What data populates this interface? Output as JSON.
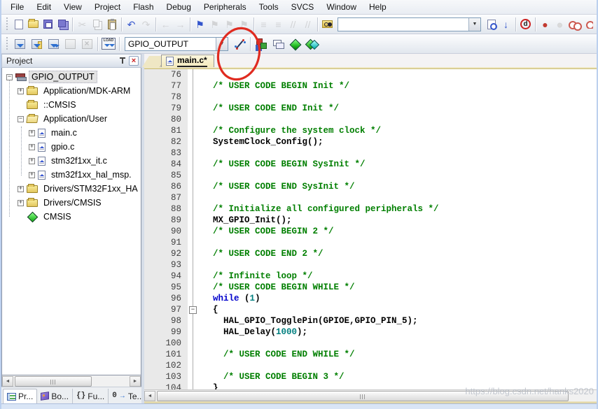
{
  "glyphs": {
    "plus": "+",
    "minus": "−",
    "fold_minus": "−",
    "scroll_left": "◄",
    "scroll_right": "►",
    "dropdown": "▼",
    "close": "×"
  },
  "colors": {
    "comment": "#007f00",
    "keyword": "#0000cc",
    "number": "#007f7f",
    "annotation": "#e02b20",
    "breakpoint_red": "#c23a30"
  },
  "menu": {
    "items": [
      "File",
      "Edit",
      "View",
      "Project",
      "Flash",
      "Debug",
      "Peripherals",
      "Tools",
      "SVCS",
      "Window",
      "Help"
    ]
  },
  "toolbar1": {
    "search_value": "",
    "buttons": [
      {
        "name": "new-file",
        "icon": "i-doc",
        "en": true
      },
      {
        "name": "open",
        "icon": "i-folder",
        "en": true
      },
      {
        "name": "save",
        "icon": "i-save",
        "en": true
      },
      {
        "name": "save-all",
        "icon": "i-saveall",
        "en": true
      },
      {
        "sep": true
      },
      {
        "name": "cut",
        "glyph": "✂",
        "cls": "g-gray",
        "en": false
      },
      {
        "name": "copy",
        "icon": "i-copy",
        "en": false
      },
      {
        "name": "paste",
        "icon": "i-paste",
        "en": true
      },
      {
        "sep": true
      },
      {
        "name": "undo",
        "glyph": "↶",
        "cls": "g-blue",
        "en": true
      },
      {
        "name": "redo",
        "glyph": "↷",
        "cls": "g-gray",
        "en": false
      },
      {
        "sep": true
      },
      {
        "name": "nav-back",
        "glyph": "←",
        "cls": "g-gray",
        "en": false
      },
      {
        "name": "nav-forward",
        "glyph": "→",
        "cls": "g-gray",
        "en": false
      },
      {
        "sep": true
      },
      {
        "name": "bookmark-toggle",
        "glyph": "⚑",
        "cls": "g-blue",
        "en": true
      },
      {
        "name": "bookmark-previous",
        "glyph": "⚑",
        "cls": "g-gray",
        "en": false
      },
      {
        "name": "bookmark-next",
        "glyph": "⚑",
        "cls": "g-gray",
        "en": false
      },
      {
        "name": "bookmark-clear-all",
        "glyph": "⚑",
        "cls": "g-gray",
        "en": false
      },
      {
        "sep": true
      },
      {
        "name": "indent",
        "glyph": "≡",
        "cls": "g-gray",
        "en": false
      },
      {
        "name": "unindent",
        "glyph": "≡",
        "cls": "g-gray",
        "en": false
      },
      {
        "name": "comment-selection",
        "glyph": "//",
        "cls": "g-gray",
        "en": false
      },
      {
        "name": "uncomment-selection",
        "glyph": "//",
        "cls": "g-gray",
        "en": false
      },
      {
        "sep": true
      },
      {
        "name": "find-in-files",
        "icon": "i-findfiles",
        "en": true
      },
      {
        "combo": "search"
      },
      {
        "name": "find",
        "icon": "i-find",
        "en": true
      },
      {
        "name": "incremental-find",
        "glyph": "↓",
        "cls": "g-blue",
        "en": true
      },
      {
        "sep": true
      },
      {
        "name": "find-all-references",
        "icon": "i-findd",
        "glyph": "d",
        "en": true
      },
      {
        "sep": true
      },
      {
        "name": "insert-breakpoint",
        "glyph": "●",
        "cls": "g-red",
        "en": true
      },
      {
        "name": "enable-disable-breakpoint",
        "glyph": "●",
        "cls": "g-light",
        "en": true
      },
      {
        "name": "kill-all-breakpoints",
        "icon": "i-bpkill",
        "en": true
      },
      {
        "name": "disable-all-breakpoints",
        "icon": "i-bpdis",
        "en": true
      }
    ]
  },
  "toolbar2": {
    "target_value": "GPIO_OUTPUT",
    "load_label": "LOAD",
    "buttons": [
      {
        "name": "translate",
        "icon": "i-build1",
        "en": true
      },
      {
        "name": "build",
        "icon": "i-build2",
        "en": true
      },
      {
        "name": "rebuild-all",
        "icon": "i-build3",
        "en": true
      },
      {
        "name": "batch-build",
        "icon": "i-build4",
        "en": false
      },
      {
        "name": "stop-build",
        "icon": "i-stop",
        "en": false
      },
      {
        "sep": true
      },
      {
        "name": "download",
        "icon": "i-load",
        "en": true
      },
      {
        "sep": true
      },
      {
        "combo": "target"
      },
      {
        "name": "options-for-target",
        "icon": "i-wand",
        "en": true
      },
      {
        "sep": true
      },
      {
        "name": "file-extensions-books",
        "icon": "i-cube",
        "en": true
      },
      {
        "name": "manage-project-items",
        "icon": "i-manage",
        "en": true
      },
      {
        "name": "manage-run-time-environment",
        "icon": "i-rte",
        "en": true
      },
      {
        "name": "pack-installer",
        "icon": "i-pack",
        "en": true
      }
    ]
  },
  "project_panel": {
    "title": "Project",
    "tree": [
      {
        "label": "GPIO_OUTPUT",
        "level": 0,
        "icon": "target",
        "expand": "minus",
        "selected": true
      },
      {
        "label": "Application/MDK-ARM",
        "level": 1,
        "icon": "folder",
        "expand": "plus"
      },
      {
        "label": "::CMSIS",
        "level": 1,
        "icon": "folder",
        "expand": null
      },
      {
        "label": "Application/User",
        "level": 1,
        "icon": "folder-open",
        "expand": "minus"
      },
      {
        "label": "main.c",
        "level": 2,
        "icon": "file",
        "expand": "plus"
      },
      {
        "label": "gpio.c",
        "level": 2,
        "icon": "file",
        "expand": "plus"
      },
      {
        "label": "stm32f1xx_it.c",
        "level": 2,
        "icon": "file",
        "expand": "plus"
      },
      {
        "label": "stm32f1xx_hal_msp.",
        "level": 2,
        "icon": "file",
        "expand": "plus"
      },
      {
        "label": "Drivers/STM32F1xx_HA",
        "level": 1,
        "icon": "folder",
        "expand": "plus"
      },
      {
        "label": "Drivers/CMSIS",
        "level": 1,
        "icon": "folder",
        "expand": "plus"
      },
      {
        "label": "CMSIS",
        "level": 1,
        "icon": "diamond",
        "expand": null
      }
    ]
  },
  "bottom_tabs": [
    {
      "name": "project",
      "icon": "ptab",
      "label": "Pr...",
      "active": true
    },
    {
      "name": "books",
      "icon": "book",
      "label": "Bo...",
      "active": false
    },
    {
      "name": "functions",
      "glyph": "{}",
      "label": "Fu...",
      "active": false
    },
    {
      "name": "templates",
      "glyph": "0",
      "glyph2": "→",
      "label": "Te...",
      "active": false
    }
  ],
  "editor": {
    "tab_label": "main.c*",
    "lines": [
      {
        "n": 76,
        "parts": []
      },
      {
        "n": 77,
        "parts": [
          {
            "t": "  /* USER CODE BEGIN Init */",
            "c": "com"
          }
        ]
      },
      {
        "n": 78,
        "parts": []
      },
      {
        "n": 79,
        "parts": [
          {
            "t": "  /* USER CODE END Init */",
            "c": "com"
          }
        ]
      },
      {
        "n": 80,
        "parts": []
      },
      {
        "n": 81,
        "parts": [
          {
            "t": "  /* Configure the system clock */",
            "c": "com"
          }
        ]
      },
      {
        "n": 82,
        "parts": [
          {
            "t": "  SystemClock_Config();",
            "c": "pln"
          }
        ]
      },
      {
        "n": 83,
        "parts": []
      },
      {
        "n": 84,
        "parts": [
          {
            "t": "  /* USER CODE BEGIN SysInit */",
            "c": "com"
          }
        ]
      },
      {
        "n": 85,
        "parts": []
      },
      {
        "n": 86,
        "parts": [
          {
            "t": "  /* USER CODE END SysInit */",
            "c": "com"
          }
        ]
      },
      {
        "n": 87,
        "parts": []
      },
      {
        "n": 88,
        "parts": [
          {
            "t": "  /* Initialize all configured peripherals */",
            "c": "com"
          }
        ]
      },
      {
        "n": 89,
        "parts": [
          {
            "t": "  MX_GPIO_Init();",
            "c": "pln"
          }
        ]
      },
      {
        "n": 90,
        "parts": [
          {
            "t": "  /* USER CODE BEGIN 2 */",
            "c": "com"
          }
        ]
      },
      {
        "n": 91,
        "parts": []
      },
      {
        "n": 92,
        "parts": [
          {
            "t": "  /* USER CODE END 2 */",
            "c": "com"
          }
        ]
      },
      {
        "n": 93,
        "parts": []
      },
      {
        "n": 94,
        "parts": [
          {
            "t": "  /* Infinite loop */",
            "c": "com"
          }
        ]
      },
      {
        "n": 95,
        "parts": [
          {
            "t": "  /* USER CODE BEGIN WHILE */",
            "c": "com"
          }
        ]
      },
      {
        "n": 96,
        "parts": [
          {
            "t": "  ",
            "c": "pln"
          },
          {
            "t": "while",
            "c": "kw"
          },
          {
            "t": " (",
            "c": "pln"
          },
          {
            "t": "1",
            "c": "num"
          },
          {
            "t": ")",
            "c": "pln"
          }
        ]
      },
      {
        "n": 97,
        "fold": "minus",
        "parts": [
          {
            "t": "  {",
            "c": "pln"
          }
        ]
      },
      {
        "n": 98,
        "parts": [
          {
            "t": "    HAL_GPIO_TogglePin(GPIOE,GPIO_PIN_5);",
            "c": "pln"
          }
        ]
      },
      {
        "n": 99,
        "parts": [
          {
            "t": "    HAL_Delay(",
            "c": "pln"
          },
          {
            "t": "1000",
            "c": "num"
          },
          {
            "t": ");",
            "c": "pln"
          }
        ]
      },
      {
        "n": 100,
        "parts": []
      },
      {
        "n": 101,
        "parts": [
          {
            "t": "    /* USER CODE END WHILE */",
            "c": "com"
          }
        ]
      },
      {
        "n": 102,
        "parts": []
      },
      {
        "n": 103,
        "parts": [
          {
            "t": "    /* USER CODE BEGIN 3 */",
            "c": "com"
          }
        ]
      },
      {
        "n": 104,
        "parts": [
          {
            "t": "  }",
            "c": "pln"
          }
        ]
      }
    ]
  },
  "watermark": "https://blog.csdn.net/hanks2020"
}
